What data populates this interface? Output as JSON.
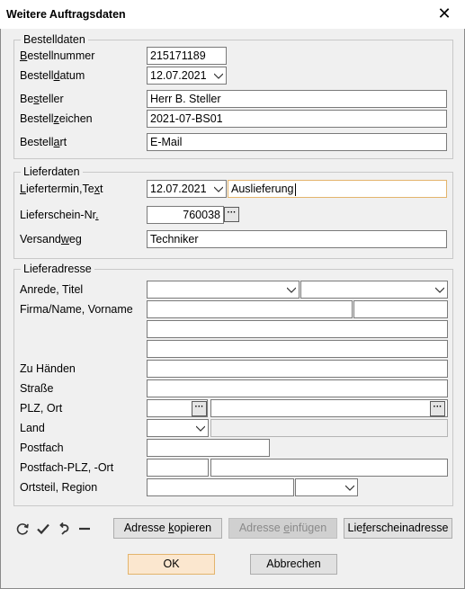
{
  "window": {
    "title": "Weitere Auftragsdaten",
    "close_glyph": "✕"
  },
  "bestell": {
    "legend": "Bestelldaten",
    "nummer": {
      "pre": "",
      "u": "B",
      "post": "estellnummer",
      "value": "215171189"
    },
    "datum": {
      "pre": "Bestell",
      "u": "d",
      "post": "atum",
      "value": "12.07.2021"
    },
    "besteller": {
      "pre": "Be",
      "u": "s",
      "post": "teller",
      "value": "Herr B. Steller"
    },
    "zeichen": {
      "pre": "Bestell",
      "u": "z",
      "post": "eichen",
      "value": "2021-07-BS01"
    },
    "art": {
      "pre": "Bestell",
      "u": "a",
      "post": "rt",
      "value": "E-Mail"
    }
  },
  "liefer": {
    "legend": "Lieferdaten",
    "termin": {
      "pre": "",
      "u": "L",
      "post": "iefertermin,Te",
      "u2": "x",
      "post2": "t",
      "date": "12.07.2021",
      "text": "Auslieferung"
    },
    "schein": {
      "pre": "Lieferschein-Nr",
      "u": ".",
      "post": "",
      "value": "760038"
    },
    "weg": {
      "pre": "Versand",
      "u": "w",
      "post": "eg",
      "value": "Techniker"
    }
  },
  "adresse": {
    "legend": "Lieferadresse",
    "labels": {
      "anrede": "Anrede, Titel",
      "firma": "Firma/Name, Vorname",
      "zuhaenden": "Zu Händen",
      "strasse": "Straße",
      "plzort": "PLZ, Ort",
      "land": "Land",
      "postfach": "Postfach",
      "postfachplz": "Postfach-PLZ, -Ort",
      "ortsteil": "Ortsteil, Region"
    }
  },
  "buttons": {
    "kopieren": {
      "pre": "Adresse ",
      "u": "k",
      "post": "opieren"
    },
    "einfuegen": {
      "pre": "Adresse ",
      "u": "e",
      "post": "infügen"
    },
    "lieferschein": {
      "pre": "Lie",
      "u": "f",
      "post": "erscheinadresse"
    },
    "ok": "OK",
    "abbrechen": "Abbrechen"
  },
  "icons": [
    "refresh-icon",
    "check-icon",
    "undo-icon",
    "minus-icon"
  ],
  "colors": {
    "focus_border": "#e3b46c",
    "default_button_bg": "#fbe7cf"
  }
}
